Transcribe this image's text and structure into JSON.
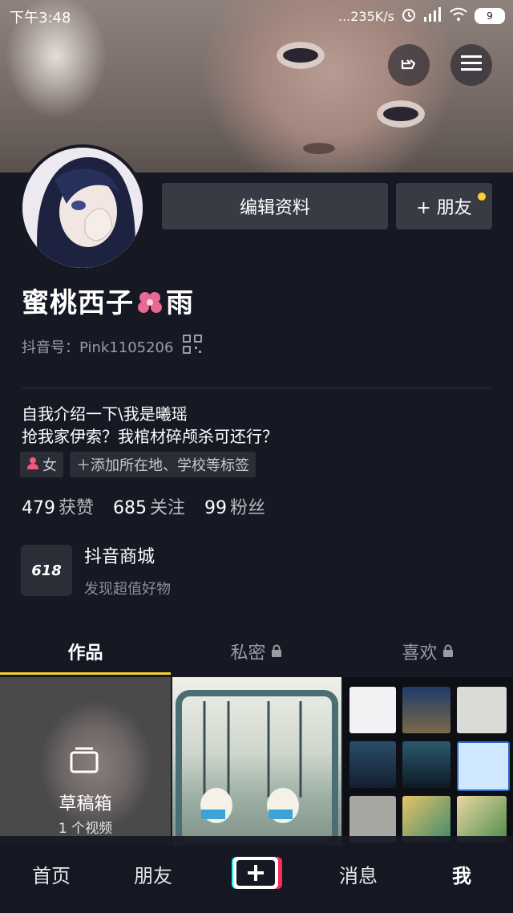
{
  "status_bar": {
    "time": "下午3:48",
    "network_speed": "...235K/s",
    "battery": "9"
  },
  "profile": {
    "edit_button": "编辑资料",
    "add_friend_button": "+ 朋友",
    "nickname": "蜜桃西子",
    "nickname_suffix": "雨",
    "douyin_id": "抖音号：Pink1105206",
    "bio_line1": "自我介绍一下\\我是曦瑶",
    "bio_line2": "抢我家伊索？我棺材碎颅杀可还行？",
    "gender_tag": "女",
    "add_tags": "＋添加所在地、学校等标签",
    "stats": [
      {
        "num": "479",
        "label": "获赞"
      },
      {
        "num": "685",
        "label": "关注"
      },
      {
        "num": "99",
        "label": "粉丝"
      }
    ]
  },
  "mall": {
    "logo_text": "618",
    "title": "抖音商城",
    "subtitle": "发现超值好物"
  },
  "tabs": [
    {
      "label": "作品",
      "locked": false
    },
    {
      "label": "私密",
      "locked": true
    },
    {
      "label": "喜欢",
      "locked": true
    }
  ],
  "drafts": {
    "title": "草稿箱",
    "count": "1 个视频"
  },
  "bottom_nav": [
    {
      "label": "首页"
    },
    {
      "label": "朋友"
    },
    {
      "label": "消息"
    },
    {
      "label": "我"
    }
  ],
  "colors": {
    "background": "#161823",
    "accent_yellow": "#fad135",
    "button_bg": "#393b44"
  }
}
